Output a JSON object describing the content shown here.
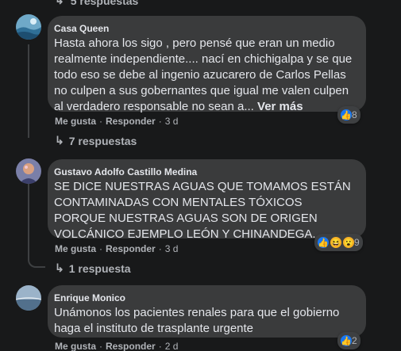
{
  "top_replies": "5 respuestas",
  "action_labels": {
    "like": "Me gusta",
    "reply": "Responder",
    "sep": "·"
  },
  "comments": [
    {
      "author": "Casa Queen",
      "text": "Hasta ahora los sigo , pero pensé que eran un medio realmente independiente.... nací en chichigalpa y se que todo eso se debe al ingenio azucarero de Carlos Pellas no culpen a sus gobernantes que igual me valen culpen al verdadero responsable no sean a...",
      "see_more": "Ver más",
      "time": "3 d",
      "reaction_count": "8",
      "replies": "7 respuestas"
    },
    {
      "author": "Gustavo Adolfo Castillo Medina",
      "text": "SE DICE NUESTRAS AGUAS QUE TOMAMOS ESTÁN CONTAMINADAS CON MENTALES TÓXICOS PORQUE NUESTRAS AGUAS SON DE ORIGEN VOLCÁNICO EJEMPLO LEÓN Y CHINANDEGA.",
      "time": "3 d",
      "reaction_count": "9",
      "replies": "1 respuesta"
    },
    {
      "author": "Enrique Monico",
      "text": "Unámonos los pacientes renales para que el gobierno haga el instituto de trasplante urgente",
      "time": "2 d",
      "reaction_count": "2"
    }
  ],
  "colors": {
    "background": "#18191a",
    "bubble": "#3a3b3c",
    "like_blue": "#1877f2",
    "secondary_text": "#b0b3b8"
  },
  "icons": {
    "like": "like-icon",
    "haha": "haha-icon",
    "wow": "wow-icon",
    "reply_arrow": "reply-arrow-icon"
  }
}
